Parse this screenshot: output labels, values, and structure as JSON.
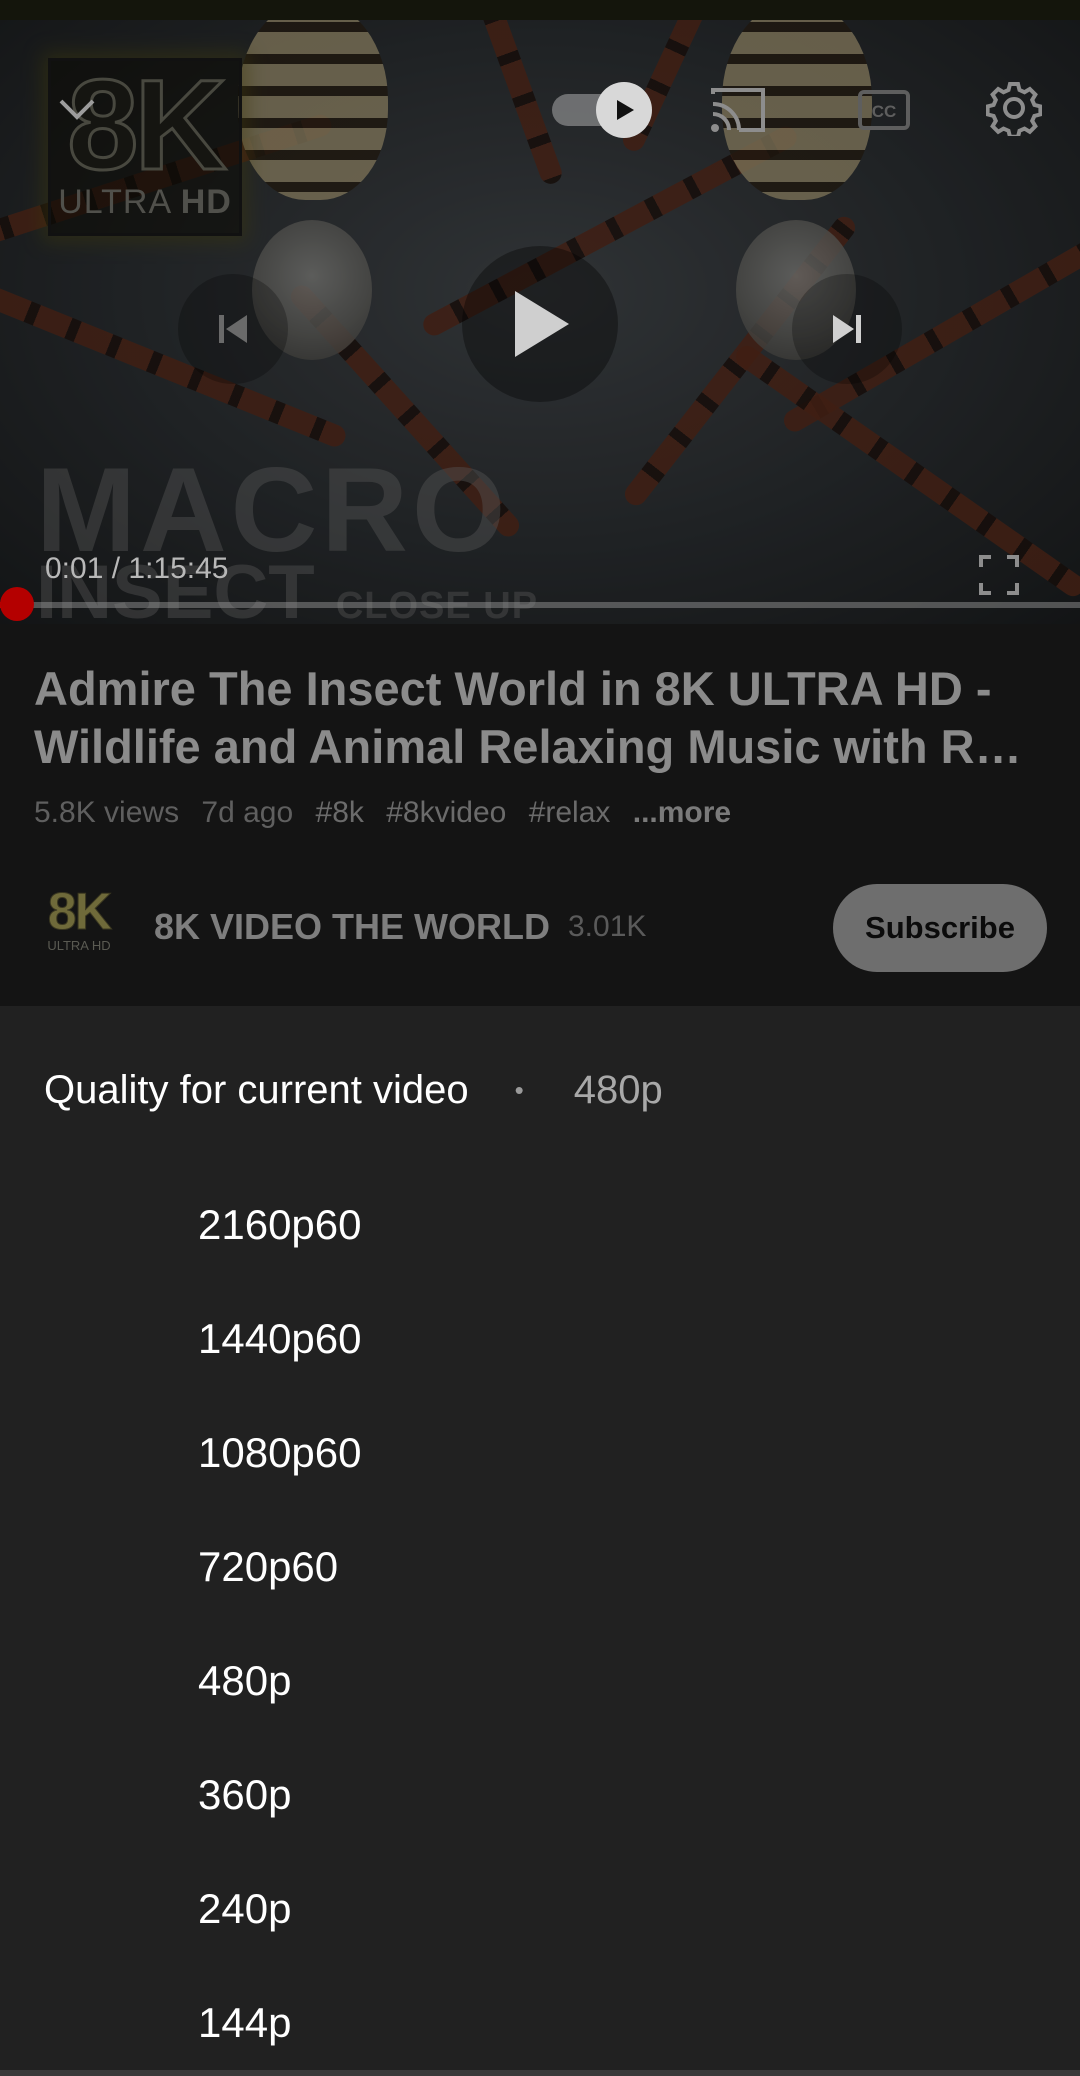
{
  "player": {
    "logo_big": "8K",
    "logo_small_a": "ULTRA ",
    "logo_small_b": "HD",
    "overlay_title_1": "MACRO",
    "overlay_title_2": "INSECT",
    "overlay_title_3": "CLOSE UP",
    "time": "0:01 / 1:15:45",
    "progress_fraction": 0.0002,
    "autoplay_on": true
  },
  "video": {
    "title_line1": "Admire The Insect World in 8K ULTRA HD -",
    "title_line2": "Wildlife and Animal Relaxing Music with Re…",
    "views": "5.8K views",
    "age": "7d ago",
    "tags": [
      "#8k",
      "#8kvideo",
      "#relax"
    ],
    "more": "...more"
  },
  "channel": {
    "avatar_big": "8K",
    "avatar_small": "ULTRA HD",
    "name": "8K VIDEO THE WORLD",
    "subscribers": "3.01K",
    "subscribe_label": "Subscribe"
  },
  "quality": {
    "header": "Quality for current video",
    "separator": "•",
    "current": "480p",
    "options": [
      "2160p60",
      "1440p60",
      "1080p60",
      "720p60",
      "480p",
      "360p",
      "240p",
      "144p"
    ]
  },
  "colors": {
    "sheet_bg": "#212121",
    "progress": "#cc0000"
  }
}
